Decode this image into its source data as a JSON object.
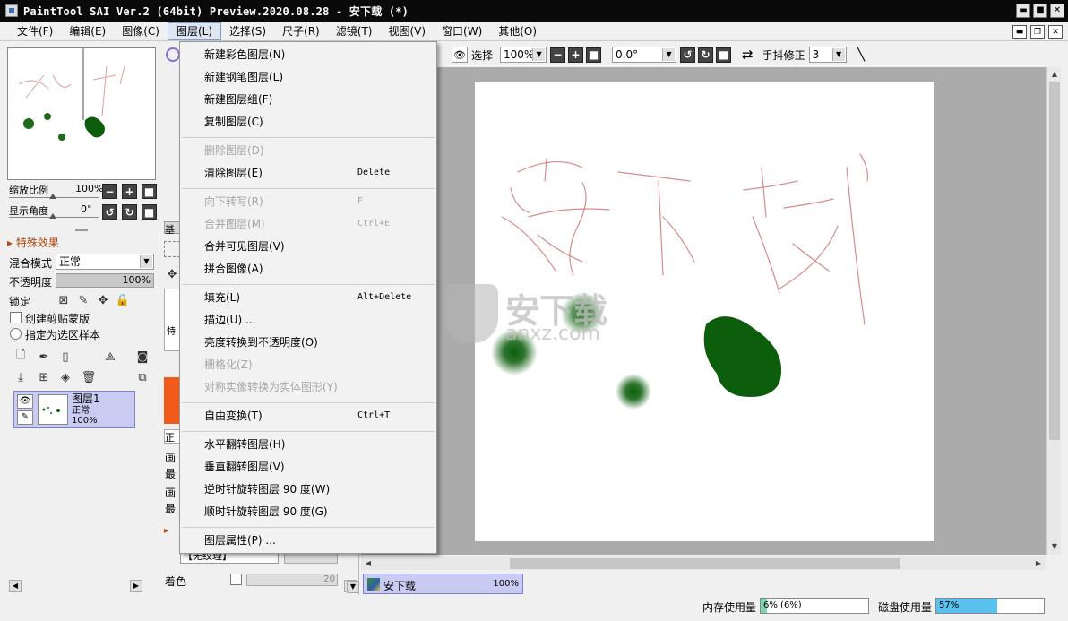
{
  "window": {
    "title": "PaintTool SAI Ver.2 (64bit) Preview.2020.08.28 - 安下载 (*)",
    "min_label": "▬",
    "max_label": "■",
    "close_label": "✕"
  },
  "menubar": {
    "items": [
      "文件(F)",
      "编辑(E)",
      "图像(C)",
      "图层(L)",
      "选择(S)",
      "尺子(R)",
      "滤镜(T)",
      "视图(V)",
      "窗口(W)",
      "其他(O)"
    ],
    "open_index": 3
  },
  "layer_menu": {
    "items": [
      {
        "label": "新建彩色图层(N)",
        "shortcut": "",
        "enabled": true
      },
      {
        "label": "新建钢笔图层(L)",
        "shortcut": "",
        "enabled": true
      },
      {
        "label": "新建图层组(F)",
        "shortcut": "",
        "enabled": true
      },
      {
        "label": "复制图层(C)",
        "shortcut": "",
        "enabled": true
      },
      {
        "label": "删除图层(D)",
        "shortcut": "",
        "enabled": false
      },
      {
        "label": "清除图层(E)",
        "shortcut": "Delete",
        "enabled": true
      },
      {
        "label": "向下转写(R)",
        "shortcut": "F",
        "enabled": false
      },
      {
        "label": "合并图层(M)",
        "shortcut": "Ctrl+E",
        "enabled": false
      },
      {
        "label": "合并可见图层(V)",
        "shortcut": "",
        "enabled": true
      },
      {
        "label": "拼合图像(A)",
        "shortcut": "",
        "enabled": true
      },
      {
        "label": "填充(L)",
        "shortcut": "Alt+Delete",
        "enabled": true
      },
      {
        "label": "描边(U) ...",
        "shortcut": "",
        "enabled": true
      },
      {
        "label": "亮度转换到不透明度(O)",
        "shortcut": "",
        "enabled": true
      },
      {
        "label": "栅格化(Z)",
        "shortcut": "",
        "enabled": false
      },
      {
        "label": "对称实像转换为实体图形(Y)",
        "shortcut": "",
        "enabled": false
      },
      {
        "label": "自由变换(T)",
        "shortcut": "Ctrl+T",
        "enabled": true
      },
      {
        "label": "水平翻转图层(H)",
        "shortcut": "",
        "enabled": true
      },
      {
        "label": "垂直翻转图层(V)",
        "shortcut": "",
        "enabled": true
      },
      {
        "label": "逆时针旋转图层 90 度(W)",
        "shortcut": "",
        "enabled": true
      },
      {
        "label": "顺时针旋转图层 90 度(G)",
        "shortcut": "",
        "enabled": true
      },
      {
        "label": "图层属性(P) ...",
        "shortcut": "",
        "enabled": true
      }
    ]
  },
  "navigator": {
    "zoom_label": "缩放比例",
    "zoom_value": "100%",
    "angle_label": "显示角度",
    "angle_value": "0°"
  },
  "effects": {
    "header": "特殊效果"
  },
  "layer_props": {
    "blend_label": "混合模式",
    "blend_value": "正常",
    "opacity_label": "不透明度",
    "opacity_value": "100%",
    "lock_label": "锁定",
    "clip_label": "创建剪贴蒙版",
    "select_sample_label": "指定为选区样本"
  },
  "layers": [
    {
      "name": "图层1",
      "mode": "正常",
      "opacity": "100%"
    }
  ],
  "toolbar": {
    "select_label": "选择",
    "zoom_value": "100%",
    "angle_value": "0.0°",
    "stabilizer_label": "手抖修正",
    "stabilizer_value": "3"
  },
  "mid_panel": {
    "color_label": "着色",
    "color_value": "20",
    "texture_value": "【无纹理】",
    "partial_1": "基",
    "partial_2": "特",
    "partial_3": "正",
    "partial_4": "画",
    "partial_5": "最",
    "partial_6": "画",
    "partial_7": "最"
  },
  "document_tab": {
    "name": "安下载",
    "zoom": "100%"
  },
  "status": {
    "memory_label": "内存使用量",
    "memory_value": "6% (6%)",
    "memory_fraction": 0.06,
    "disk_label": "磁盘使用量",
    "disk_value": "57%",
    "disk_fraction": 0.57
  },
  "colors": {
    "accent_orange": "#f25a1a",
    "stroke_green": "#0c5e0c",
    "sketch_red": "#d88a8a",
    "layer_selected": "#c9cbf2",
    "disk_bar": "#5ac0ee",
    "memory_bar": "#7fd7b0"
  },
  "watermark": {
    "text_cn": "安下载",
    "text_en": "anxz.com"
  }
}
